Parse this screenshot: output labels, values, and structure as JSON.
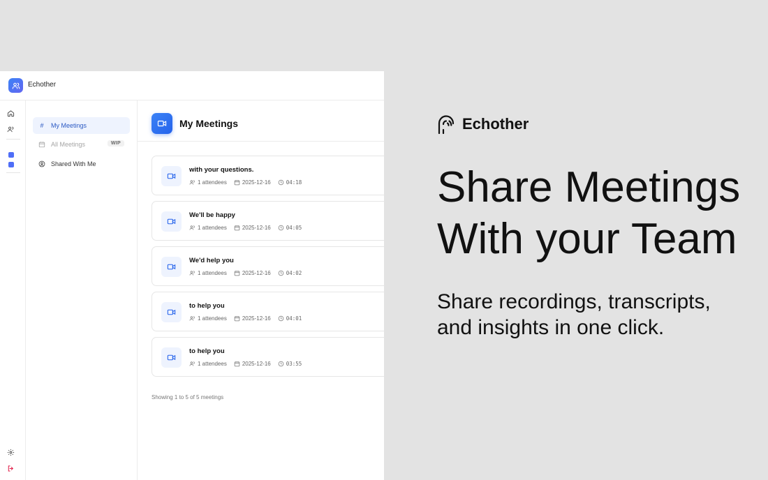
{
  "app": {
    "name": "Echother"
  },
  "subnav": {
    "items": [
      {
        "label": "My Meetings",
        "icon": "hash-icon",
        "active": true
      },
      {
        "label": "All Meetings",
        "icon": "calendar-icon",
        "badge": "WIP",
        "disabled": true
      },
      {
        "label": "Shared With Me",
        "icon": "user-circle-icon"
      }
    ]
  },
  "main": {
    "title": "My Meetings",
    "meetings": [
      {
        "title": "with your questions.",
        "attendees": "1 attendees",
        "date": "2025-12-16",
        "duration": "04:18"
      },
      {
        "title": "We'll be happy",
        "attendees": "1 attendees",
        "date": "2025-12-16",
        "duration": "04:05"
      },
      {
        "title": "We'd help you",
        "attendees": "1 attendees",
        "date": "2025-12-16",
        "duration": "04:02"
      },
      {
        "title": "to help you",
        "attendees": "1 attendees",
        "date": "2025-12-16",
        "duration": "04:01"
      },
      {
        "title": "to help you",
        "attendees": "1 attendees",
        "date": "2025-12-16",
        "duration": "03:55"
      }
    ],
    "footer": "Showing 1 to 5 of 5 meetings"
  },
  "promo": {
    "brand": "Echother",
    "headline_line1": "Share Meetings",
    "headline_line2": "With your Team",
    "subline": "Share recordings, transcripts, and insights in one click."
  },
  "colors": {
    "accent": "#2563eb",
    "active_bg": "#eef3fe",
    "page_bg": "#e3e3e3",
    "logout": "#e11d48"
  }
}
